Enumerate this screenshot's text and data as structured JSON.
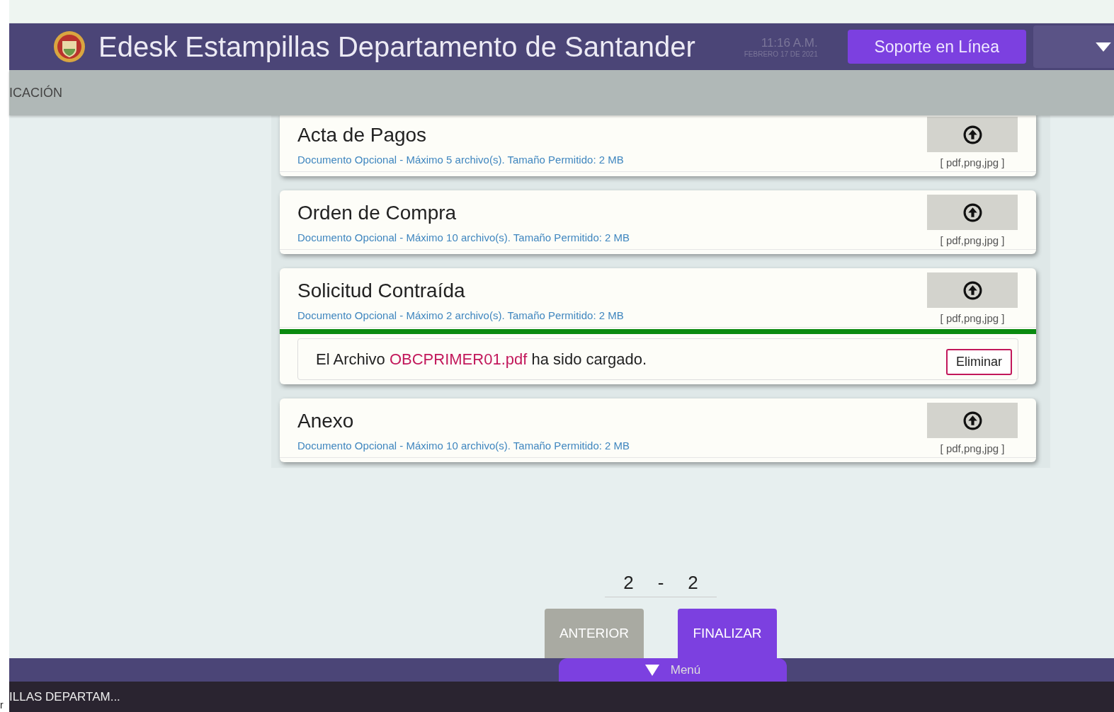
{
  "header": {
    "title": "Edesk Estampillas Departamento de Santander",
    "time": "11:16 A.M.",
    "date": "FEBRERO 17 DE 2021",
    "support_button": "Soporte en Línea"
  },
  "subbar": {
    "label": "ICACIÓN"
  },
  "documents": [
    {
      "title": "Acta de Pagos",
      "note": "Documento Opcional - Máximo 5 archivo(s). Tamaño Permitido: 2 MB",
      "formats": "[ pdf,png,jpg ]"
    },
    {
      "title": "Orden de Compra",
      "note": "Documento Opcional - Máximo 10 archivo(s). Tamaño Permitido: 2 MB",
      "formats": "[ pdf,png,jpg ]"
    },
    {
      "title": "Solicitud Contraída",
      "note": "Documento Opcional - Máximo 2 archivo(s). Tamaño Permitido: 2 MB",
      "formats": "[ pdf,png,jpg ]",
      "upload": {
        "level": 1,
        "prefix": "El Archivo",
        "file": "OBCPRIMER01.pdf",
        "suffix": "ha sido cargado.",
        "button": "Eliminar"
      }
    },
    {
      "title": "Anexo",
      "note": "Documento Opcional - Máximo 10 archivo(s). Tamaño Permitido: 2 MB",
      "formats": "[ pdf,png,jpg ]"
    }
  ],
  "pager": {
    "current": "2",
    "separator": "-",
    "total": "2"
  },
  "buttons": [
    {
      "label": "ANTERIOR",
      "disabled": true
    },
    {
      "label": "FINALIZAR",
      "disabled": false
    }
  ],
  "menu_tab": "Menú",
  "taskbar": {
    "edge_text": "r",
    "window_title": "ILLAS DEPARTAM..."
  }
}
